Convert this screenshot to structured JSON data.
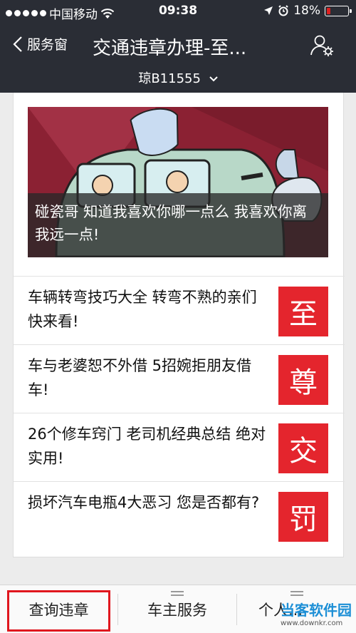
{
  "status_bar": {
    "carrier": "中国移动",
    "time": "09:38",
    "battery": "18%",
    "battery_level": 0.18
  },
  "nav": {
    "back_label": "服务窗",
    "title": "交通违章办理-至...",
    "plate": "琼B11555"
  },
  "hero": {
    "caption": "碰瓷哥 知道我喜欢你哪一点么 我喜欢你离我远一点!"
  },
  "articles": [
    {
      "title": "车辆转弯技巧大全 转弯不熟的亲们快来看!",
      "thumb": "至"
    },
    {
      "title": "车与老婆恕不外借 5招婉拒朋友借车!",
      "thumb": "尊"
    },
    {
      "title": "26个修车窍门 老司机经典总结 绝对实用!",
      "thumb": "交"
    },
    {
      "title": "损坏汽车电瓶4大恶习 您是否都有?",
      "thumb": "罚"
    }
  ],
  "tabs": [
    {
      "label": "查询违章"
    },
    {
      "label": "车主服务"
    },
    {
      "label": "个人..."
    }
  ],
  "watermark": {
    "main": "当客软件园",
    "sub": "www.downkr.com"
  },
  "colors": {
    "nav_bg": "#2a2d35",
    "accent_red": "#e4252d"
  }
}
